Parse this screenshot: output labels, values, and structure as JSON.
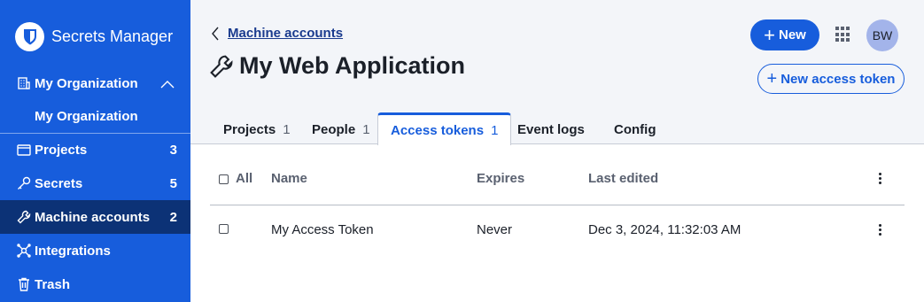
{
  "brand": {
    "name": "Secrets Manager"
  },
  "sidebar": {
    "org_header": "My Organization",
    "org_sub": "My Organization",
    "items": [
      {
        "label": "Projects",
        "count": "3"
      },
      {
        "label": "Secrets",
        "count": "5"
      },
      {
        "label": "Machine accounts",
        "count": "2"
      },
      {
        "label": "Integrations"
      },
      {
        "label": "Trash"
      }
    ]
  },
  "header": {
    "breadcrumb": "Machine accounts",
    "title": "My Web Application",
    "new_button": "New",
    "avatar_initials": "BW",
    "new_token_button": "New access token"
  },
  "tabs": [
    {
      "label": "Projects",
      "count": "1"
    },
    {
      "label": "People",
      "count": "1"
    },
    {
      "label": "Access tokens",
      "count": "1"
    },
    {
      "label": "Event logs"
    },
    {
      "label": "Config"
    }
  ],
  "table": {
    "columns": {
      "all": "All",
      "name": "Name",
      "expires": "Expires",
      "last_edited": "Last edited"
    },
    "rows": [
      {
        "name": "My Access Token",
        "expires": "Never",
        "last_edited": "Dec 3, 2024, 11:32:03 AM"
      }
    ]
  },
  "colors": {
    "accent": "#175ddc",
    "active_nav": "#0c3276",
    "header_bg": "#f3f5f9"
  }
}
